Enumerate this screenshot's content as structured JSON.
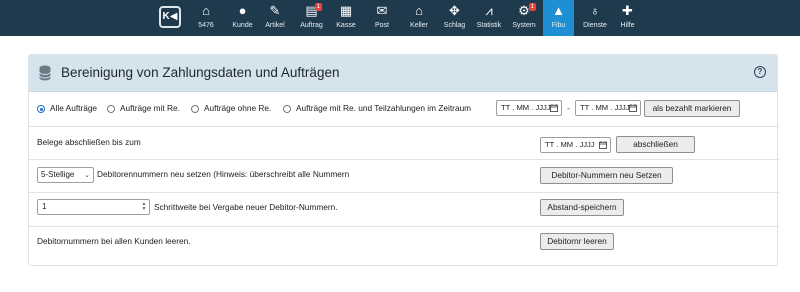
{
  "nav": {
    "items": [
      {
        "label": "5476",
        "icon": "⌂"
      },
      {
        "label": "Kunde",
        "icon": "●"
      },
      {
        "label": "Artikel",
        "icon": "✎"
      },
      {
        "label": "Auftrag",
        "icon": "▤",
        "badge": "1"
      },
      {
        "label": "Kasse",
        "icon": "▦"
      },
      {
        "label": "Post",
        "icon": "✉"
      },
      {
        "label": "Keller",
        "icon": "⌂"
      },
      {
        "label": "Schlag",
        "icon": "✥"
      },
      {
        "label": "Statistik",
        "icon": "⩘"
      },
      {
        "label": "System",
        "icon": "⚙",
        "badge": "1"
      },
      {
        "label": "Fibu",
        "icon": "▲"
      },
      {
        "label": "Dienste",
        "icon": "♁"
      },
      {
        "label": "Hilfe",
        "icon": "✚"
      }
    ],
    "active": "Fibu",
    "colors": {
      "bar": "#1f3a4d",
      "active": "#1d8fd2",
      "badge": "#e8443a"
    }
  },
  "panel": {
    "title": "Bereinigung von Zahlungsdaten und Aufträgen",
    "radios": {
      "options": [
        "Alle Aufträge",
        "Aufträge mit Re.",
        "Aufträge ohne Re.",
        "Aufträge mit Re. und Teilzahlungen im Zeitraum"
      ],
      "selected": "Alle Aufträge"
    },
    "date_from": "TT . MM . JJJJ",
    "date_sep": "-",
    "date_to": "TT . MM . JJJJ",
    "mark_paid_button": "als bezahlt markieren",
    "close_label": "Belege abschließen bis zum",
    "close_date": "TT . MM . JJJJ",
    "close_button": "abschließen",
    "digits_select": "5-Stellige",
    "digits_label": "Debitorennummern neu setzen (Hinweis: überschreibt alle Nummern",
    "digits_button": "Debitor-Nummern neu Setzen",
    "step_value": "1",
    "step_label": "Schrittweite bei Vergabe neuer Debitor-Nummern.",
    "step_button": "Abstand-speichern",
    "clear_label": "Debitornummern bei allen Kunden leeren.",
    "clear_button": "Debitornr leeren"
  }
}
